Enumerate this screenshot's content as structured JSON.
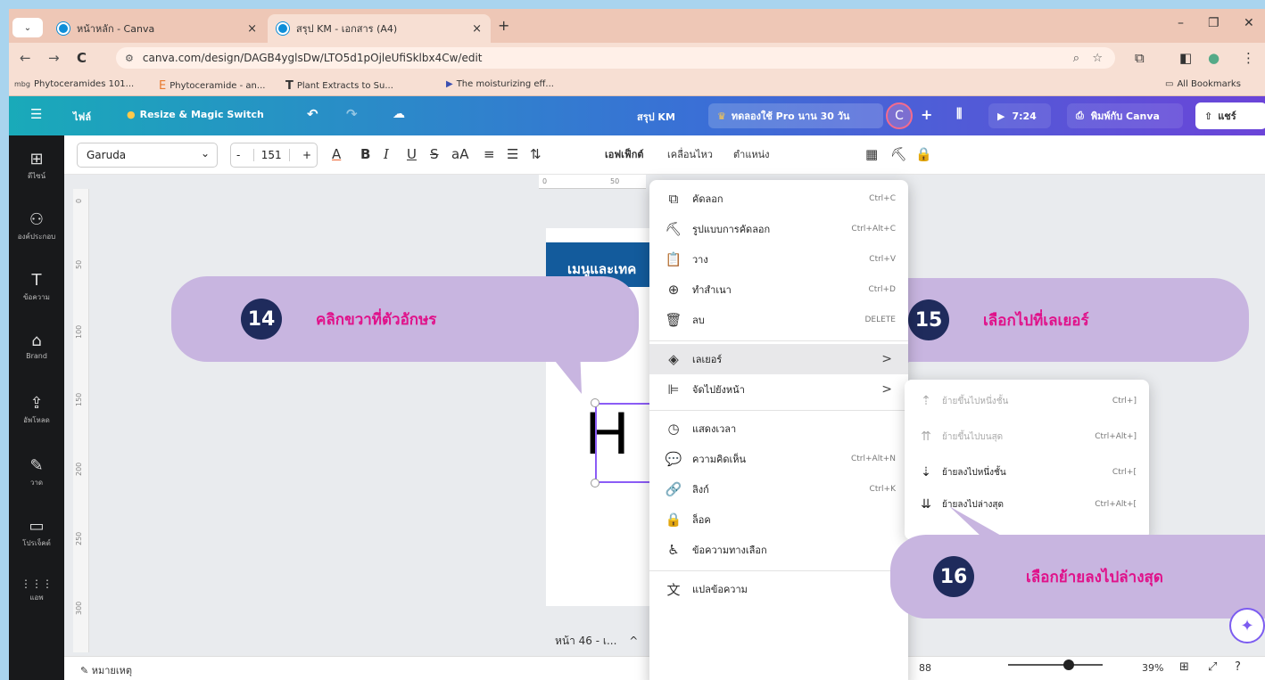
{
  "browser": {
    "tabs": [
      {
        "title": "หน้าหลัก - Canva",
        "close": "×"
      },
      {
        "title": "สรุป KM - เอกสาร (A4)",
        "close": "×"
      }
    ],
    "new_tab": "+",
    "window_controls": [
      "–",
      "❐",
      "✕"
    ],
    "nav": {
      "back": "←",
      "forward": "→",
      "reload": "C"
    },
    "url": "canva.com/design/DAGB4yglsDw/LTO5d1pOjleUfiSklbx4Cw/edit",
    "bookmarks": [
      {
        "icon": "mbg",
        "label": "Phytoceramides 101..."
      },
      {
        "icon": "E",
        "label": "Phytoceramide - an..."
      },
      {
        "icon": "T",
        "label": "Plant Extracts to Su..."
      },
      {
        "icon": "▶",
        "label": "The moisturizing eff..."
      }
    ],
    "all_bookmarks": "All Bookmarks"
  },
  "canva_header": {
    "menu_icon": "☰",
    "file": "ไฟล์",
    "resize": "Resize & Magic Switch",
    "doc_title": "สรุป KM",
    "pro_trial": "ทดลองใช้ Pro นาน 30 วัน",
    "avatar": "C",
    "plus": "+",
    "timer": "7:24",
    "print": "พิมพ์กับ Canva",
    "share": "แชร์"
  },
  "sidebar": [
    {
      "icon": "⊞",
      "label": "ดีไซน์"
    },
    {
      "icon": "⚇",
      "label": "องค์ประกอบ"
    },
    {
      "icon": "T",
      "label": "ข้อความ"
    },
    {
      "icon": "⌂",
      "label": "Brand"
    },
    {
      "icon": "⇪",
      "label": "อัพโหลด"
    },
    {
      "icon": "✎",
      "label": "วาด"
    },
    {
      "icon": "▭",
      "label": "โปรเจ็คต์"
    },
    {
      "icon": "⋮⋮⋮",
      "label": "แอพ"
    }
  ],
  "format_toolbar": {
    "font": "Garuda",
    "size": "151",
    "minus": "-",
    "plus": "+",
    "effects": "เอฟเฟ็กต์",
    "animate": "เคลื่อนไหว",
    "position": "ตำแหน่ง",
    "icons": [
      "A",
      "B",
      "I",
      "U",
      "S",
      "aA",
      "≡",
      "☰",
      "⇅"
    ]
  },
  "canvas": {
    "ruler_h": [
      "0",
      "50"
    ],
    "ruler_v": [
      "0",
      "50",
      "100",
      "150",
      "200",
      "250",
      "300"
    ],
    "banner_text": "เมนูและเทค",
    "big_text": "H",
    "page_label": "หน้า 46 - เ...",
    "page_label_chevron": "^"
  },
  "context_menu": [
    {
      "icon": "⧉",
      "label": "คัดลอก",
      "shortcut": "Ctrl+C"
    },
    {
      "icon": "⛏",
      "label": "รูปแบบการคัดลอก",
      "shortcut": "Ctrl+Alt+C"
    },
    {
      "icon": "📋",
      "label": "วาง",
      "shortcut": "Ctrl+V"
    },
    {
      "icon": "⊕",
      "label": "ทำสำเนา",
      "shortcut": "Ctrl+D"
    },
    {
      "icon": "🗑",
      "label": "ลบ",
      "shortcut": "DELETE"
    },
    {
      "icon": "◈",
      "label": "เลเยอร์",
      "arrow": ">"
    },
    {
      "icon": "⊫",
      "label": "จัดไปยังหน้า",
      "arrow": ">"
    },
    {
      "icon": "◷",
      "label": "แสดงเวลา"
    },
    {
      "icon": "💬",
      "label": "ความคิดเห็น",
      "shortcut": "Ctrl+Alt+N"
    },
    {
      "icon": "🔗",
      "label": "ลิงก์",
      "shortcut": "Ctrl+K"
    },
    {
      "icon": "🔒",
      "label": "ล็อค"
    },
    {
      "icon": "♿",
      "label": "ข้อความทางเลือก"
    },
    {
      "icon": "文",
      "label": "แปลข้อความ"
    }
  ],
  "layer_submenu": [
    {
      "icon": "⇡",
      "label": "ย้ายขึ้นไปหนึ่งชั้น",
      "shortcut": "Ctrl+]",
      "disabled": true
    },
    {
      "icon": "⇈",
      "label": "ย้ายขึ้นไปบนสุด",
      "shortcut": "Ctrl+Alt+]",
      "disabled": true
    },
    {
      "icon": "⇣",
      "label": "ย้ายลงไปหนึ่งชั้น",
      "shortcut": "Ctrl+[",
      "disabled": false
    },
    {
      "icon": "⇊",
      "label": "ย้ายลงไปล่างสุด",
      "shortcut": "Ctrl+Alt+[",
      "disabled": false
    }
  ],
  "callouts": [
    {
      "number": "14",
      "text": "คลิกขวาที่ตัวอักษร"
    },
    {
      "number": "15",
      "text": "เลือกไปที่เลเยอร์"
    },
    {
      "number": "16",
      "text": "เลือกย้ายลงไปล่างสุด"
    }
  ],
  "bottom_bar": {
    "notes": "หมายเหตุ",
    "page_count": "88",
    "zoom": "39%",
    "magic_icon": "✦"
  },
  "colors": {
    "callout_bg": "#c8b5e0",
    "callout_text": "#e0118a",
    "number_bg": "#1f2b5c",
    "selection": "#8b5cf6"
  }
}
